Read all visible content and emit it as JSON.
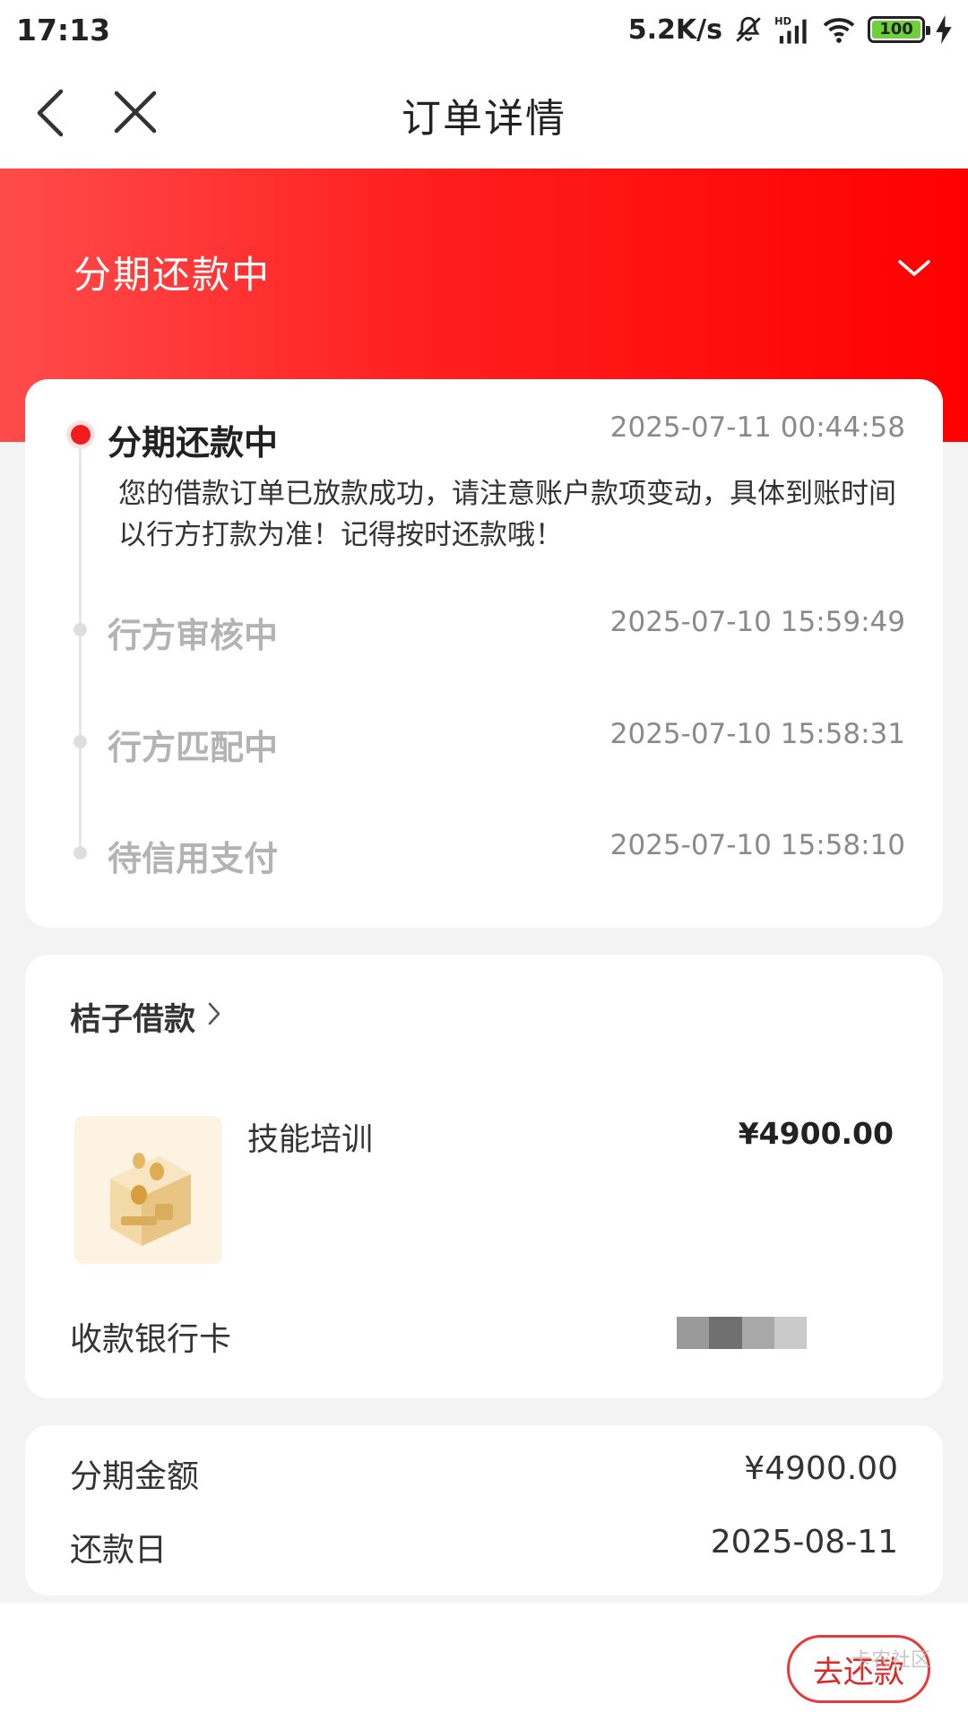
{
  "status_bar": {
    "time": "17:13",
    "net_speed": "5.2K/s",
    "battery": "100",
    "icons": [
      "bell-off-icon",
      "hd-signal-icon",
      "wifi-icon",
      "battery-icon",
      "charging-icon"
    ]
  },
  "navbar": {
    "title": "订单详情",
    "back_icon": "back-arrow-icon",
    "close_icon": "close-icon"
  },
  "header": {
    "status": "分期还款中",
    "expand_icon": "chevron-down-icon",
    "accent": "#ff1e1e"
  },
  "timeline": [
    {
      "title": "分期还款中",
      "time": "2025-07-11 00:44:58",
      "desc": "您的借款订单已放款成功，请注意账户款项变动，具体到账时间以行方打款为准！记得按时还款哦！",
      "active": true
    },
    {
      "title": "行方审核中",
      "time": "2025-07-10 15:59:49",
      "active": false
    },
    {
      "title": "行方匹配中",
      "time": "2025-07-10 15:58:31",
      "active": false
    },
    {
      "title": "待信用支付",
      "time": "2025-07-10 15:58:10",
      "active": false
    }
  ],
  "product": {
    "merchant": "桔子借款",
    "name": "技能培训",
    "price": "¥4900.00",
    "bank_label": "收款银行卡"
  },
  "summary": {
    "amount_label": "分期金额",
    "amount_value": "¥4900.00",
    "due_label": "还款日",
    "due_value": "2025-08-11"
  },
  "bottom": {
    "repay_button": "去还款",
    "watermark": "卡农社区"
  }
}
